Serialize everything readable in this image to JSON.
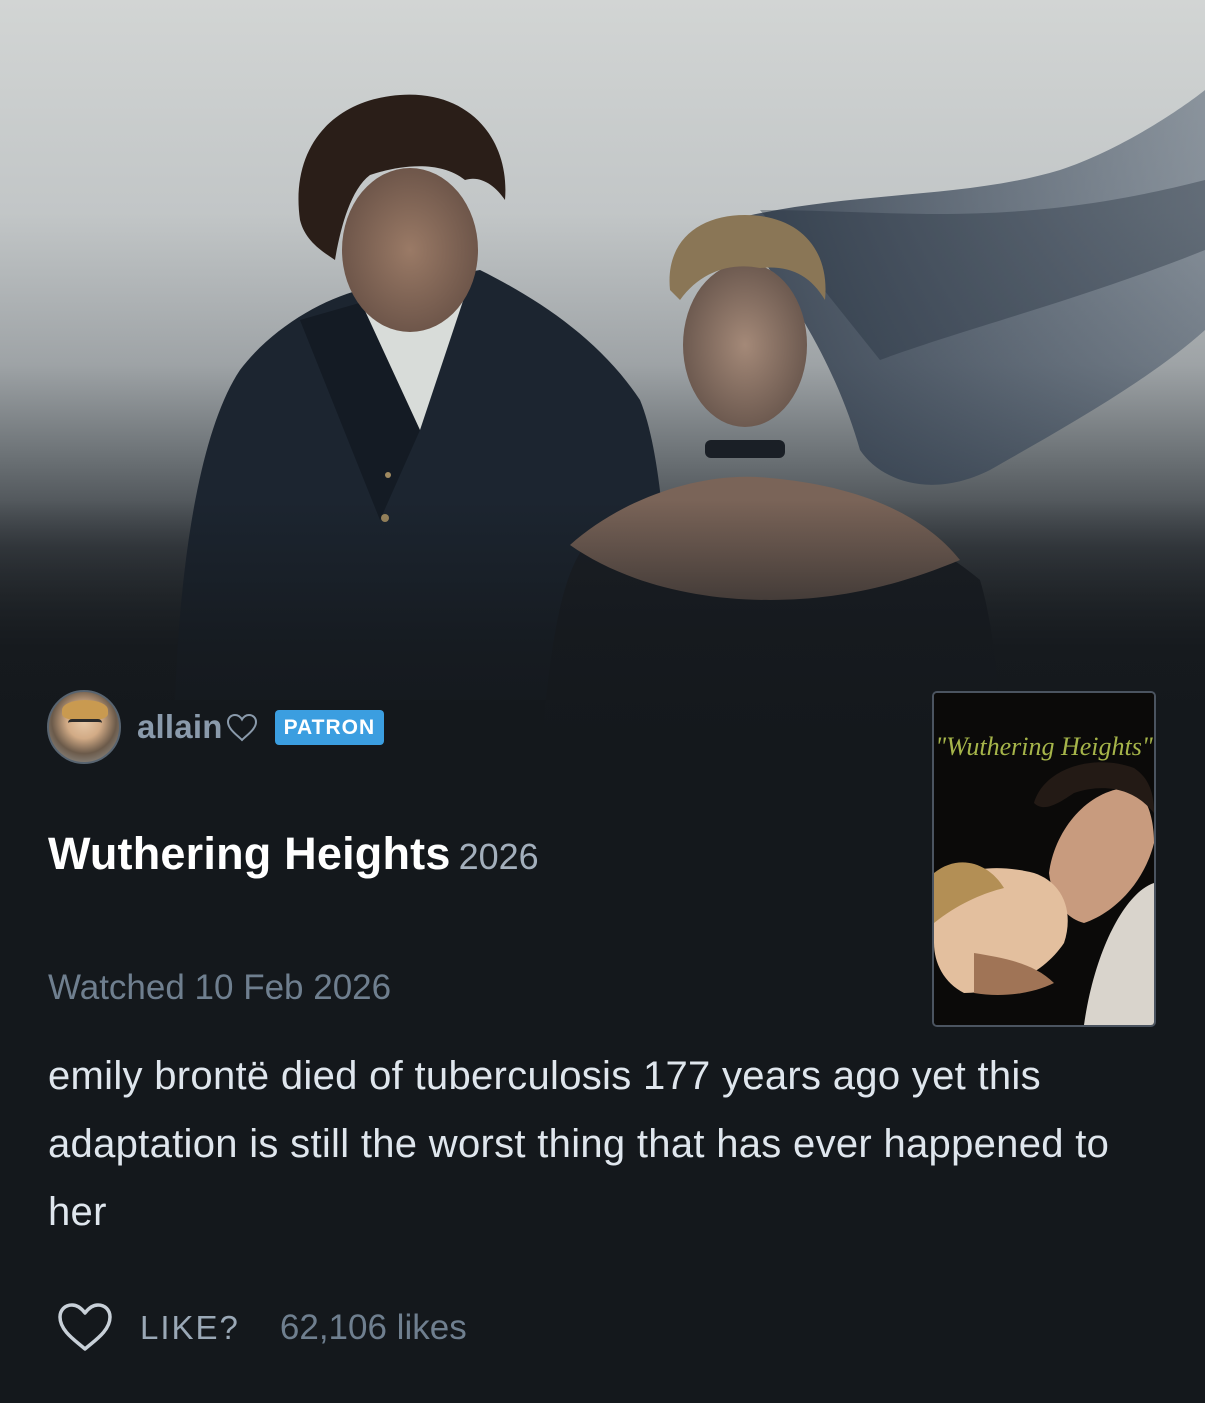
{
  "review": {
    "author": {
      "username": "allain",
      "badge": "PATRON",
      "avatar_icon": "user-avatar"
    },
    "film": {
      "title": "Wuthering Heights",
      "year": "2026",
      "poster_title": "\"Wuthering Heights\""
    },
    "watched_label": "Watched 10 Feb 2026",
    "text": "emily brontë died of tuberculosis 177 years ago yet this adaptation is still the worst thing that has ever happened to her",
    "actions": {
      "like_label": "LIKE?",
      "like_count": "62,106 likes"
    }
  },
  "colors": {
    "background": "#14181c",
    "badge": "#3b9ee0",
    "muted_text": "#6f7f8f",
    "username": "#8a9aab"
  },
  "icons": [
    "heart-outline-icon",
    "heart-like-icon"
  ]
}
